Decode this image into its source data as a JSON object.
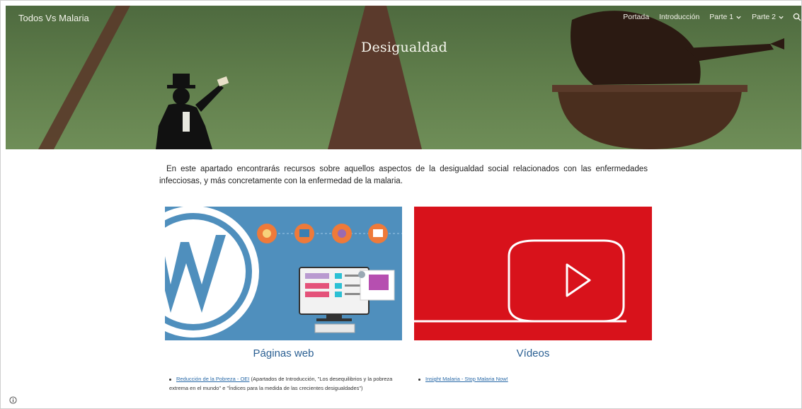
{
  "header": {
    "site_title": "Todos Vs Malaria",
    "page_title": "Desigualdad",
    "nav": [
      {
        "label": "Portada",
        "dropdown": false
      },
      {
        "label": "Introducción",
        "dropdown": false
      },
      {
        "label": "Parte 1",
        "dropdown": true
      },
      {
        "label": "Parte 2",
        "dropdown": true
      }
    ],
    "icons": {
      "search": "search-icon",
      "chevron": "chevron-down-icon"
    }
  },
  "intro": {
    "text": "En este apartado encontrarás recursos sobre aquellos aspectos de la desigualdad social relacionados con las enfermedades infecciosas, y más concretamente con la enfermedad de la malaria."
  },
  "cards": [
    {
      "title": "Páginas web",
      "bg_color": "#4f8fbd",
      "links": [
        {
          "link_text": "Reducción de la Pobreza - OEI",
          "note": " (Apartados de Introducción, \"Los desequilibrios y la pobreza extrema en el mundo\" e \"Índices para la medida de las crecientes desigualdades\")"
        }
      ]
    },
    {
      "title": "Vídeos",
      "bg_color": "#d8121b",
      "links": [
        {
          "link_text": "Insight Malaria - Stop Malaria Now!",
          "note": ""
        }
      ]
    }
  ],
  "colors": {
    "hero": "#5e7c4a",
    "accent": "#2a5f92",
    "link": "#2a6aa8"
  },
  "footer": {
    "info_icon": "info-icon"
  }
}
